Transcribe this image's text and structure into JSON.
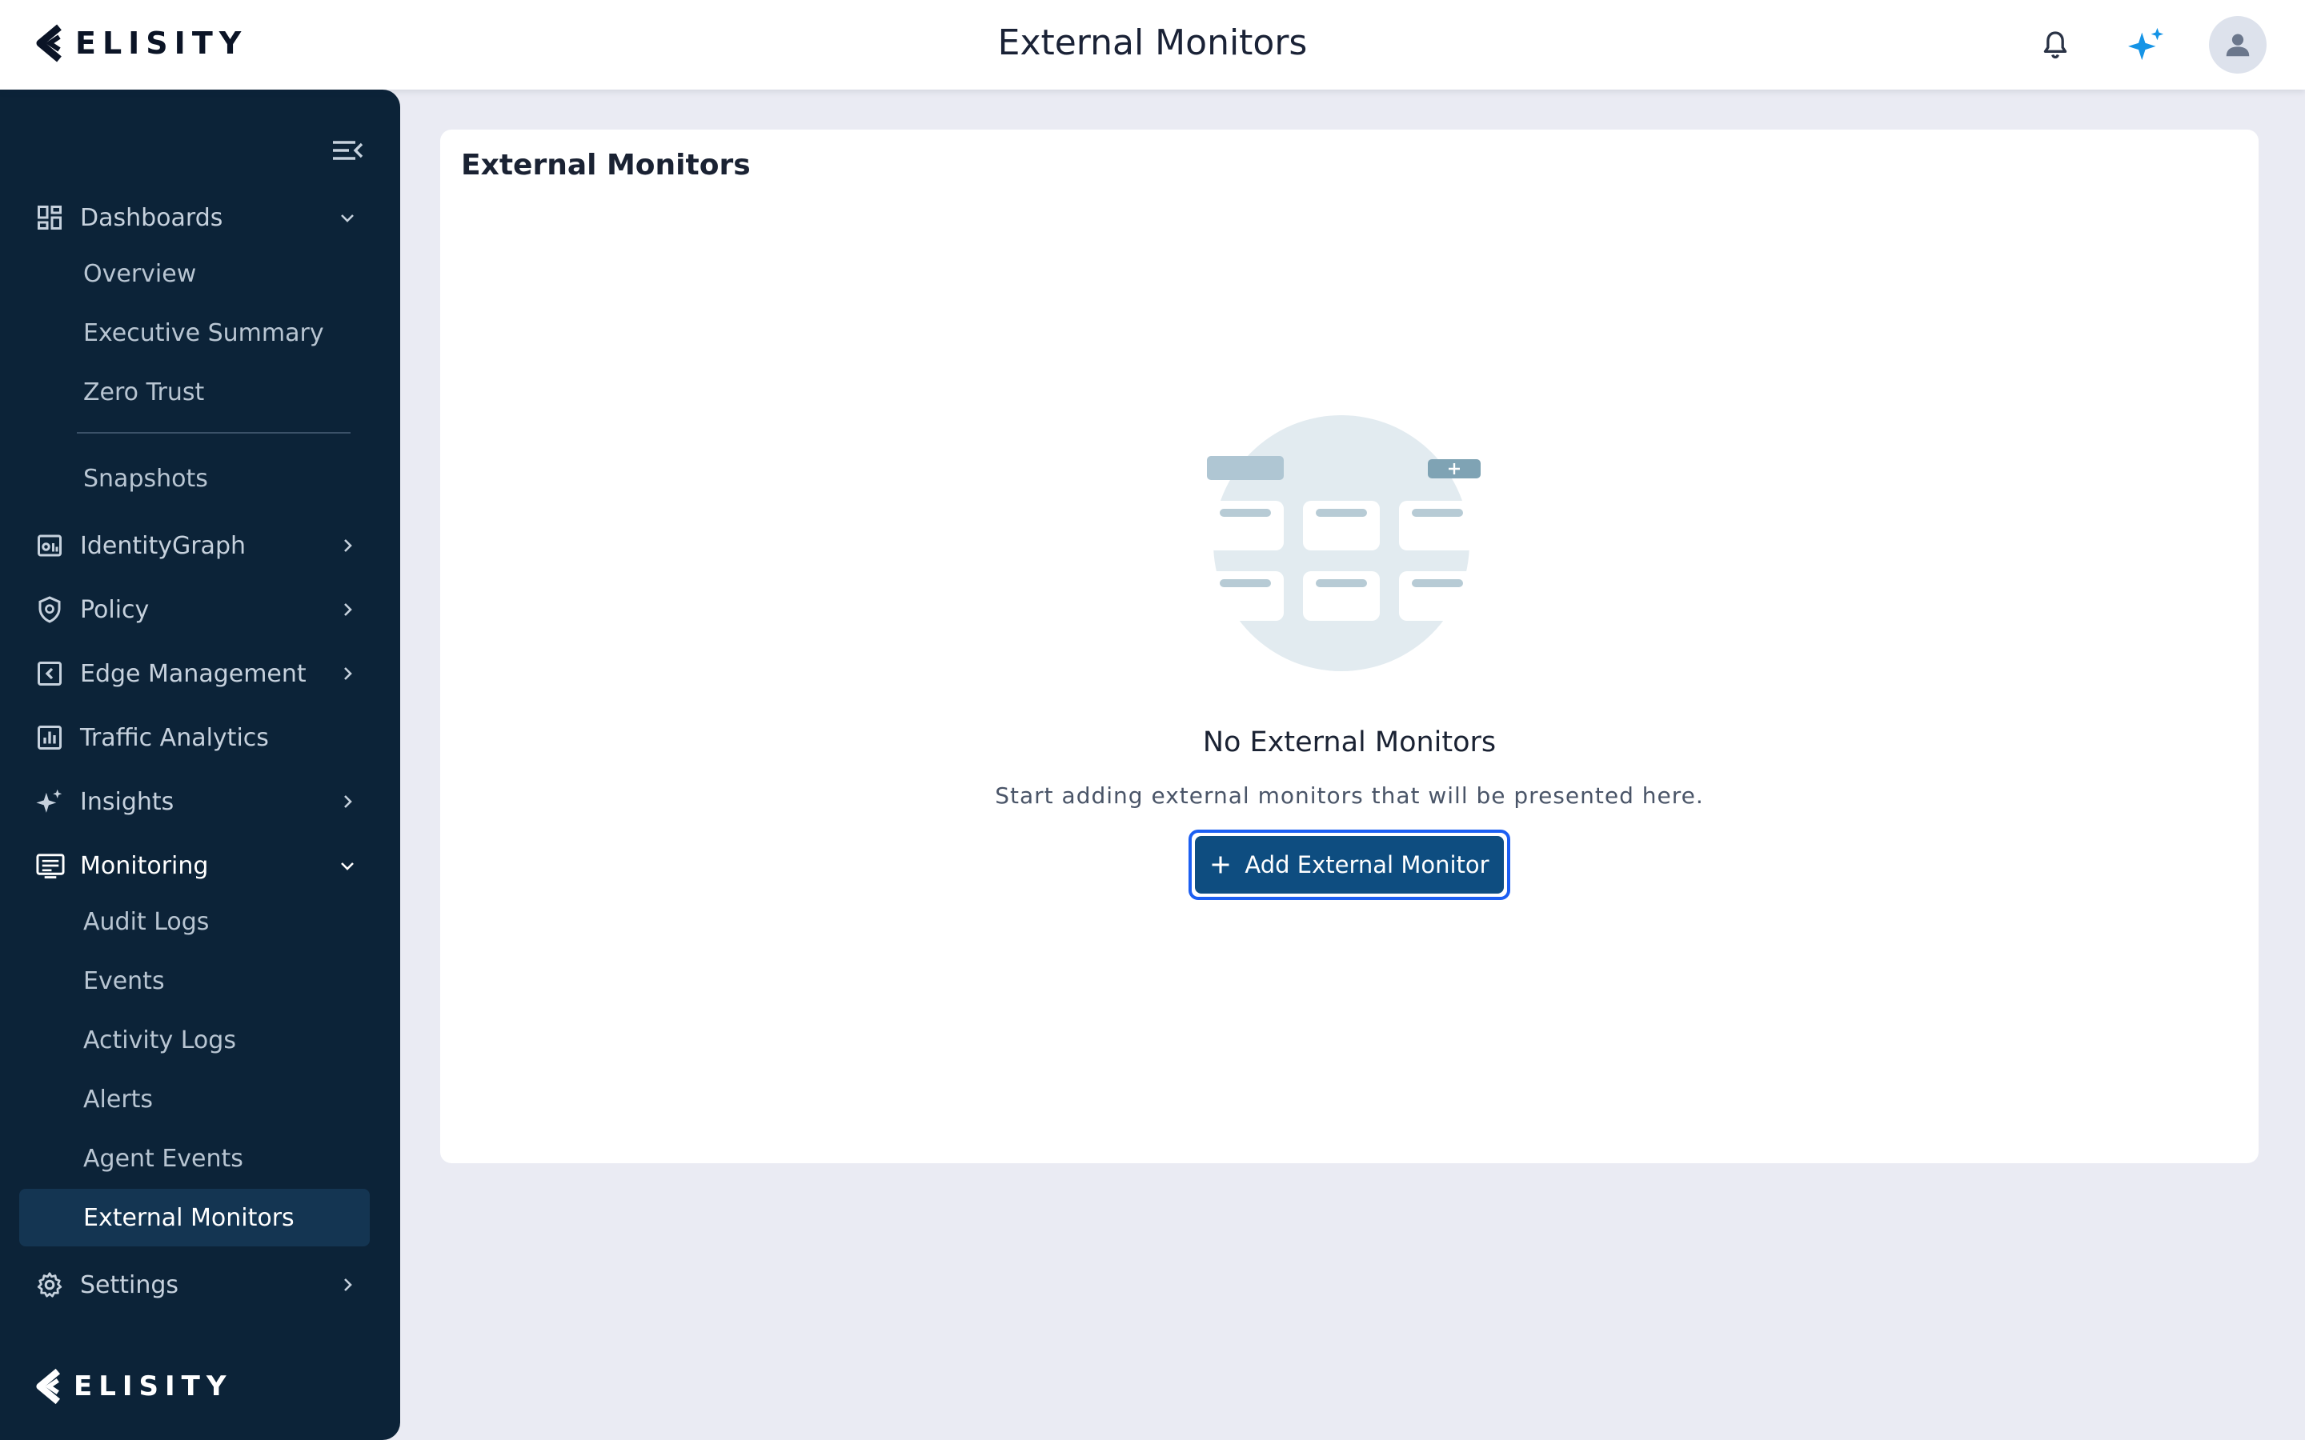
{
  "brand": {
    "logo_text": "ELISITY"
  },
  "header": {
    "title": "External Monitors"
  },
  "top_actions": {
    "icons": [
      "bell-icon",
      "sparkle-ai-icon",
      "user-avatar-icon"
    ],
    "ai_color": "#1594e6"
  },
  "sidebar": {
    "collapse_icon": "menu-collapse-icon",
    "dashboards": {
      "label": "Dashboards",
      "children": [
        "Overview",
        "Executive Summary",
        "Zero Trust",
        "Snapshots"
      ]
    },
    "items": [
      "IdentityGraph",
      "Policy",
      "Edge Management",
      "Traffic Analytics",
      "Insights"
    ],
    "monitoring": {
      "label": "Monitoring",
      "children": [
        "Audit Logs",
        "Events",
        "Activity Logs",
        "Alerts",
        "Agent Events",
        "External Monitors"
      ]
    },
    "settings": "Settings",
    "selected": "External Monitors"
  },
  "main": {
    "card_title": "External Monitors",
    "empty_title": "No External Monitors",
    "empty_desc": "Start adding external monitors that will be presented here.",
    "add_button": "Add External Monitor"
  },
  "colors": {
    "sidebar_bg": "#0c2338",
    "selected_bg": "#143552",
    "button_bg": "#0e4d80",
    "focus_ring": "#1c5ff2",
    "page_bg": "#eaebf3"
  }
}
